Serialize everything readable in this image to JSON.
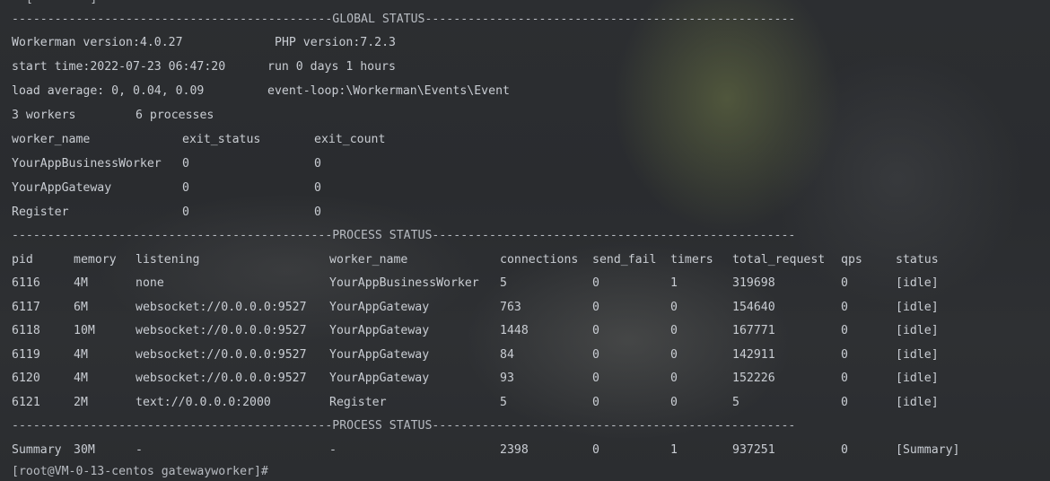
{
  "top_cut_line": "  [        ]  ",
  "global_separator": "---------------------------------------------GLOBAL STATUS----------------------------------------------------",
  "global": {
    "version": "Workerman version:4.0.27",
    "php": "PHP version:7.2.3",
    "start_time": "start time:2022-07-23 06:47:20",
    "run_time": "run 0 days 1 hours",
    "load": "load average: 0, 0.04, 0.09",
    "event_loop": "event-loop:\\Workerman\\Events\\Event",
    "workers": "3 workers",
    "processes": "6 processes"
  },
  "worker_table": {
    "headers": [
      "worker_name",
      "exit_status",
      "exit_count"
    ],
    "rows": [
      [
        "YourAppBusinessWorker",
        "0",
        "0"
      ],
      [
        "YourAppGateway",
        "0",
        "0"
      ],
      [
        "Register",
        "0",
        "0"
      ]
    ]
  },
  "process_separator": "---------------------------------------------PROCESS STATUS---------------------------------------------------",
  "process_table": {
    "headers": [
      "pid",
      "memory",
      "listening",
      "worker_name",
      "connections",
      "send_fail",
      "timers",
      "total_request",
      "qps",
      "status"
    ],
    "rows": [
      [
        "6116",
        "4M",
        "none",
        "YourAppBusinessWorker",
        "5",
        "0",
        "1",
        "319698",
        "0",
        "[idle]"
      ],
      [
        "6117",
        "6M",
        "websocket://0.0.0.0:9527",
        "YourAppGateway",
        "763",
        "0",
        "0",
        "154640",
        "0",
        "[idle]"
      ],
      [
        "6118",
        "10M",
        "websocket://0.0.0.0:9527",
        "YourAppGateway",
        "1448",
        "0",
        "0",
        "167771",
        "0",
        "[idle]"
      ],
      [
        "6119",
        "4M",
        "websocket://0.0.0.0:9527",
        "YourAppGateway",
        "84",
        "0",
        "0",
        "142911",
        "0",
        "[idle]"
      ],
      [
        "6120",
        "4M",
        "websocket://0.0.0.0:9527",
        "YourAppGateway",
        "93",
        "0",
        "0",
        "152226",
        "0",
        "[idle]"
      ],
      [
        "6121",
        "2M",
        "text://0.0.0.0:2000",
        "Register",
        "5",
        "0",
        "0",
        "5",
        "0",
        "[idle]"
      ]
    ]
  },
  "process_separator_2": "---------------------------------------------PROCESS STATUS---------------------------------------------------",
  "summary": [
    "Summary",
    "30M",
    "-",
    "-",
    "2398",
    "0",
    "1",
    "937251",
    "0",
    "[Summary]"
  ],
  "prompt_partial": "[root@VM-0-13-centos gatewayworker]#"
}
